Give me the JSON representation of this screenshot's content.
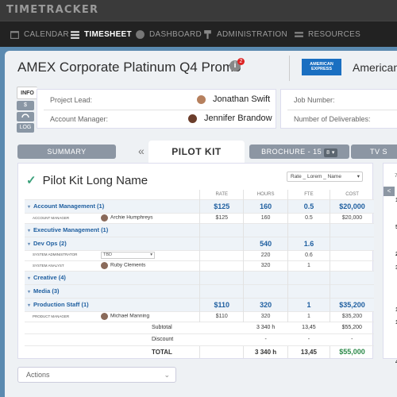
{
  "app": {
    "brand": "TIMETRACKER"
  },
  "nav": {
    "items": [
      {
        "label": "CALENDAR",
        "icon": "calendar-icon"
      },
      {
        "label": "TIMESHEET",
        "icon": "list-icon",
        "active": true
      },
      {
        "label": "DASHBOARD",
        "icon": "globe-icon"
      },
      {
        "label": "ADMINISTRATION",
        "icon": "wrench-icon"
      },
      {
        "label": "RESOURCES",
        "icon": "people-icon"
      }
    ]
  },
  "project": {
    "title": "AMEX Corporate Platinum Q4 Promo",
    "notification_count": "2",
    "logo_text": "AMERICAN EXPRESS",
    "client": "American E"
  },
  "side_tabs": [
    "INFO",
    "$",
    "LOG"
  ],
  "info": {
    "project_lead_label": "Project Lead:",
    "project_lead": "Jonathan Swift",
    "account_manager_label": "Account Manager:",
    "account_manager": "Jennifer Brandow",
    "job_number_label": "Job Number:",
    "deliverables_label": "Number of Deliverables:"
  },
  "tabs": {
    "summary": "SUMMARY",
    "active": "PILOT KIT",
    "brochure": "BROCHURE - 15",
    "brochure_badge": "8 ▾",
    "tv": "TV S"
  },
  "panel": {
    "title": "Pilot Kit Long Name",
    "dropdown": "Rate _ Lorem _ Name",
    "columns": [
      "RATE",
      "HOURS",
      "FTE",
      "COST"
    ],
    "rows": [
      {
        "kind": "group",
        "name": "Account Management",
        "count": "(1)",
        "rate": "$125",
        "hours": "160",
        "fte": "0.5",
        "cost": "$20,000"
      },
      {
        "kind": "person",
        "role": "ACCOUNT MANAGER",
        "person": "Archie Humphreys",
        "rate": "$125",
        "hours": "160",
        "fte": "0.5",
        "cost": "$20,000"
      },
      {
        "kind": "group",
        "name": "Executive Management",
        "count": "(1)",
        "rate": "",
        "hours": "",
        "fte": "",
        "cost": ""
      },
      {
        "kind": "group",
        "name": "Dev Ops",
        "count": "(2)",
        "rate": "",
        "hours": "540",
        "fte": "1.6",
        "cost": ""
      },
      {
        "kind": "person",
        "role": "SYSTEM ADMINISTRATOR",
        "person": "TBD",
        "tbd": true,
        "rate": "",
        "hours": "220",
        "fte": "0.6",
        "cost": ""
      },
      {
        "kind": "person",
        "role": "SYSTEM ANALYST",
        "person": "Ruby Clements",
        "rate": "",
        "hours": "320",
        "fte": "1",
        "cost": ""
      },
      {
        "kind": "group",
        "name": "Creative",
        "count": "(4)",
        "rate": "",
        "hours": "",
        "fte": "",
        "cost": ""
      },
      {
        "kind": "group",
        "name": "Media",
        "count": "(3)",
        "rate": "",
        "hours": "",
        "fte": "",
        "cost": ""
      },
      {
        "kind": "group",
        "name": "Production Staff",
        "count": "(1)",
        "rate": "$110",
        "hours": "320",
        "fte": "1",
        "cost": "$35,200"
      },
      {
        "kind": "person",
        "role": "PRODUCT MANAGER",
        "person": "Michael Manning",
        "rate": "$110",
        "hours": "320",
        "fte": "1",
        "cost": "$35,200"
      }
    ],
    "subtotal": {
      "label": "Subtotal",
      "hours": "3 340 h",
      "fte": "13,45",
      "cost": "$55,200"
    },
    "discount": {
      "label": "Discount",
      "hours": "-",
      "fte": "-",
      "cost": "-"
    },
    "total": {
      "label": "TOTAL",
      "hours": "3 340 h",
      "fte": "13,45",
      "cost": "$55,000"
    }
  },
  "peek": {
    "date": "7/",
    "nav": "<",
    "values": [
      "16",
      "",
      "5",
      "",
      "22",
      "32",
      "",
      "",
      "16",
      "16",
      "",
      "",
      "40"
    ]
  },
  "actions": {
    "label": "Actions"
  }
}
